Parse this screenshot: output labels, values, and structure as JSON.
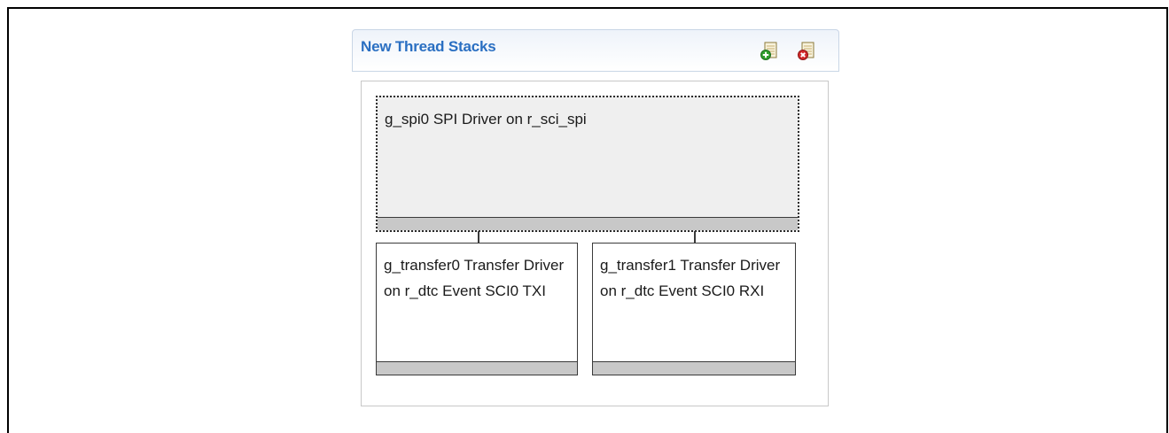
{
  "panel": {
    "title": "New Thread Stacks",
    "add_icon": "add-stack-icon",
    "remove_icon": "remove-stack-icon"
  },
  "modules": {
    "parent": {
      "label": "g_spi0 SPI Driver on r_sci_spi"
    },
    "children": [
      {
        "label": "g_transfer0 Transfer Driver on r_dtc Event SCI0 TXI"
      },
      {
        "label": "g_transfer1 Transfer Driver on r_dtc Event SCI0 RXI"
      }
    ]
  },
  "colors": {
    "title": "#2a6fc2",
    "module_bg": "#ffffff",
    "selected_bg": "#efefef",
    "bar": "#c8c8c8"
  }
}
